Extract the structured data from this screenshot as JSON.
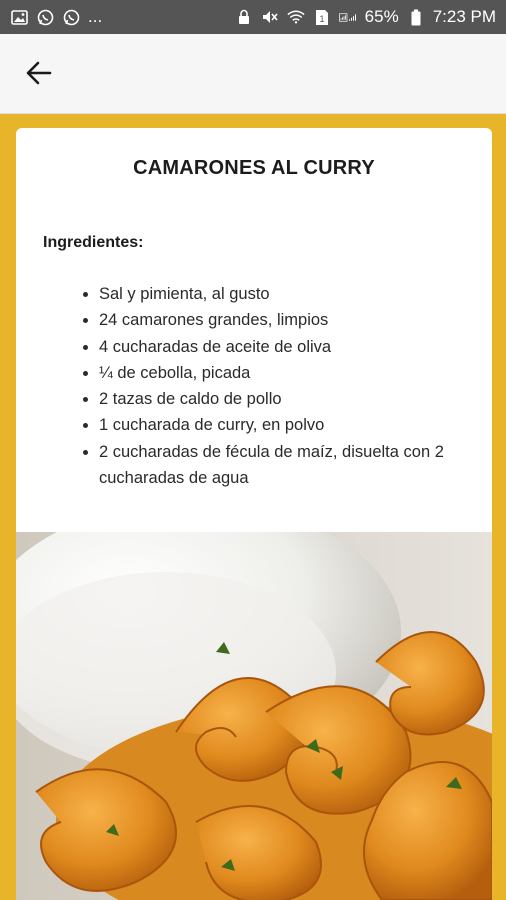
{
  "status_bar": {
    "notif_more": "...",
    "battery_pct": "65%",
    "time": "7:23 PM",
    "icons_left": [
      "gallery-icon",
      "whatsapp-icon",
      "whatsapp-icon"
    ],
    "icons_right": [
      "lock-icon",
      "mute-icon",
      "wifi-icon",
      "sim-icon",
      "signal-icon",
      "battery-icon"
    ]
  },
  "app_bar": {
    "back_icon": "arrow-back-icon"
  },
  "recipe": {
    "title": "CAMARONES AL CURRY",
    "ingredients_heading": "Ingredientes:",
    "ingredients": [
      "Sal y pimienta, al gusto",
      "24 camarones grandes, limpios",
      "4 cucharadas de aceite de oliva",
      "¼ de cebolla, picada",
      "2 tazas de caldo de pollo",
      "1 cucharada de curry, en polvo",
      "2 cucharadas de fécula de maíz, disuelta con 2 cucharadas de agua"
    ]
  },
  "colors": {
    "accent": "#e8b52a",
    "status_bar": "#555555",
    "app_bar": "#f6f6f6",
    "card": "#ffffff"
  }
}
